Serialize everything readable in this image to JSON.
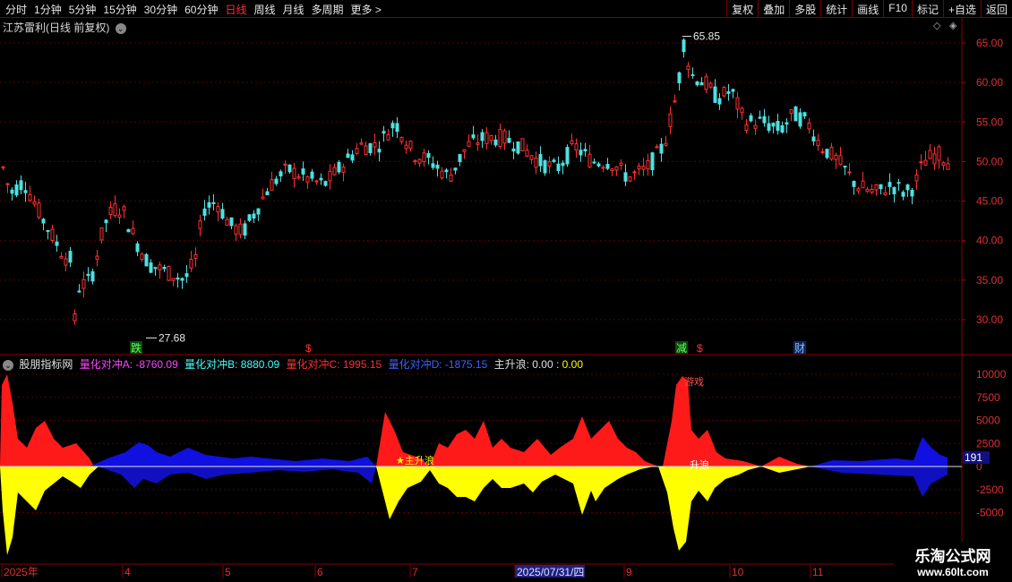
{
  "toolbar": {
    "periods": [
      "分时",
      "1分钟",
      "5分钟",
      "15分钟",
      "30分钟",
      "60分钟",
      "日线",
      "周线",
      "月线",
      "多周期",
      "更多 >"
    ],
    "active_index": 6,
    "right_buttons": [
      "复权",
      "叠加",
      "多股",
      "统计",
      "画线",
      "F10",
      "标记",
      "+自选",
      "返回"
    ]
  },
  "main": {
    "title": "江苏雷利(日线 前复权)",
    "price_axis": [
      "65.00",
      "60.00",
      "55.00",
      "50.00",
      "45.00",
      "40.00",
      "35.00",
      "30.00"
    ],
    "high_label": "65.85",
    "low_label": "27.68",
    "markers": {
      "m1": "跌",
      "m2": "$",
      "m3": "减",
      "m4": "$",
      "m5": "财"
    }
  },
  "indicator": {
    "title": "股朋指标网",
    "items": [
      {
        "label": "量化对冲A: -8760.09",
        "color": "#ff44ff"
      },
      {
        "label": "量化对冲B: 8880.09",
        "color": "#44ffff"
      },
      {
        "label": "量化对冲C: 1995.15",
        "color": "#ff3030"
      },
      {
        "label": "量化对冲D: -1875.15",
        "color": "#4060ff"
      },
      {
        "label": "主升浪: 0.00",
        "color": "#e0e0e0"
      },
      {
        "label": ": 0.00",
        "color": "#ffff00"
      }
    ],
    "axis": [
      "10000",
      "7500",
      "5000",
      "2500",
      "0",
      "-2500",
      "-5000"
    ],
    "current_value": "191",
    "annotations": {
      "a1": "主升浪",
      "a2": "游戏",
      "a3": "升浪"
    }
  },
  "date_axis": {
    "labels": [
      "2025年",
      "4",
      "5",
      "6",
      "7",
      "2025/07/31/四",
      "9",
      "10",
      "11"
    ]
  },
  "watermark": {
    "line1": "乐淘公式网",
    "line2": "www.60lt.com"
  },
  "colors": {
    "up": "#ff3030",
    "down": "#4fe0e0",
    "grid": "#5a0000"
  }
}
